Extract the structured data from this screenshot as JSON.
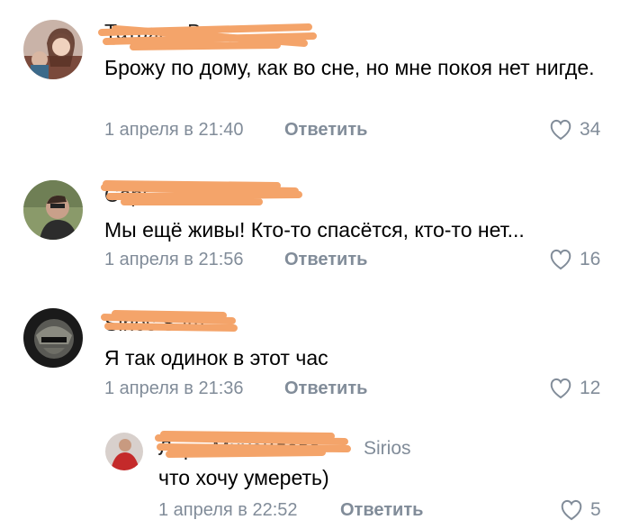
{
  "comments": [
    {
      "author": "Татьяна В.",
      "text": "Брожу по дому, как во сне, но мне покоя нет нигде.",
      "date": "1 апреля в 21:40",
      "reply_label": "Ответить",
      "likes": "34"
    },
    {
      "author": "Серг...",
      "text": "Мы ещё живы! Кто-то спасётся, кто-то нет...",
      "date": "1 апреля в 21:56",
      "reply_label": "Ответить",
      "likes": "16"
    },
    {
      "author": "Sirios Sam",
      "text": "Я так одинок в этот час",
      "date": "1 апреля в 21:36",
      "reply_label": "Ответить",
      "likes": "12"
    }
  ],
  "reply": {
    "author": "Лера Михайлова",
    "reply_to": "Sirios",
    "text": "что хочу умереть)",
    "date": "1 апреля в 22:52",
    "reply_label": "Ответить",
    "likes": "5"
  },
  "colors": {
    "meta": "#818c99",
    "scribble": "#f4a46a"
  },
  "icons": {
    "like": "heart-outline-icon"
  }
}
